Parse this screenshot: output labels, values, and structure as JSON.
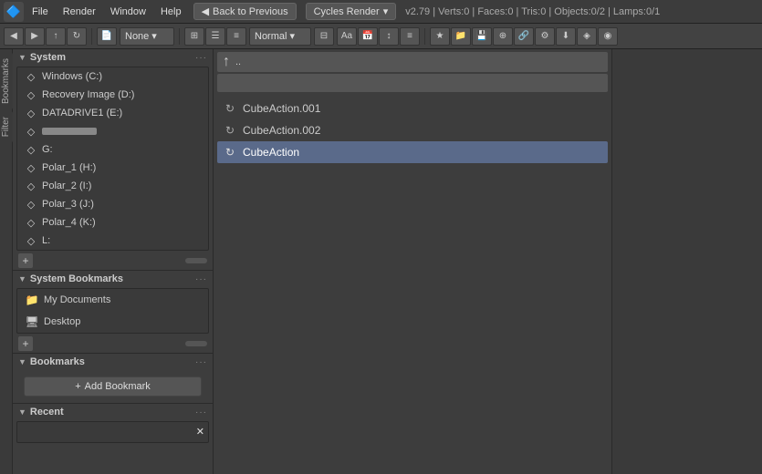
{
  "menubar": {
    "icon": "🔷",
    "items": [
      "File",
      "Render",
      "Window",
      "Help"
    ],
    "back_button": "Back to Previous",
    "render_engine": "Cycles Render",
    "version_info": "v2.79 | Verts:0 | Faces:0 | Tris:0 | Objects:0/2 | Lamps:0/1"
  },
  "toolbar2": {
    "normal_label": "Normal",
    "none_label": "None"
  },
  "sidebar": {
    "tabs": [
      "Bookmarks",
      "Filter"
    ],
    "system_section": "System",
    "system_items": [
      {
        "label": "Windows (C:)"
      },
      {
        "label": "Recovery Image (D:)"
      },
      {
        "label": "DATADRIVE1 (E:)"
      },
      {
        "label": ""
      },
      {
        "label": "G:"
      },
      {
        "label": "Polar_1 (H:)"
      },
      {
        "label": "Polar_2 (I:)"
      },
      {
        "label": "Polar_3 (J:)"
      },
      {
        "label": "Polar_4 (K:)"
      },
      {
        "label": "L:"
      }
    ],
    "bookmarks_section": "System Bookmarks",
    "bookmark_items": [
      {
        "label": "My Documents"
      },
      {
        "label": "Desktop"
      }
    ],
    "user_bookmarks_section": "Bookmarks",
    "add_bookmark_label": "Add Bookmark",
    "recent_section": "Recent"
  },
  "file_area": {
    "path": "..",
    "items": [
      {
        "label": "CubeAction.001",
        "selected": false
      },
      {
        "label": "CubeAction.002",
        "selected": false
      },
      {
        "label": "CubeAction",
        "selected": true
      }
    ]
  }
}
